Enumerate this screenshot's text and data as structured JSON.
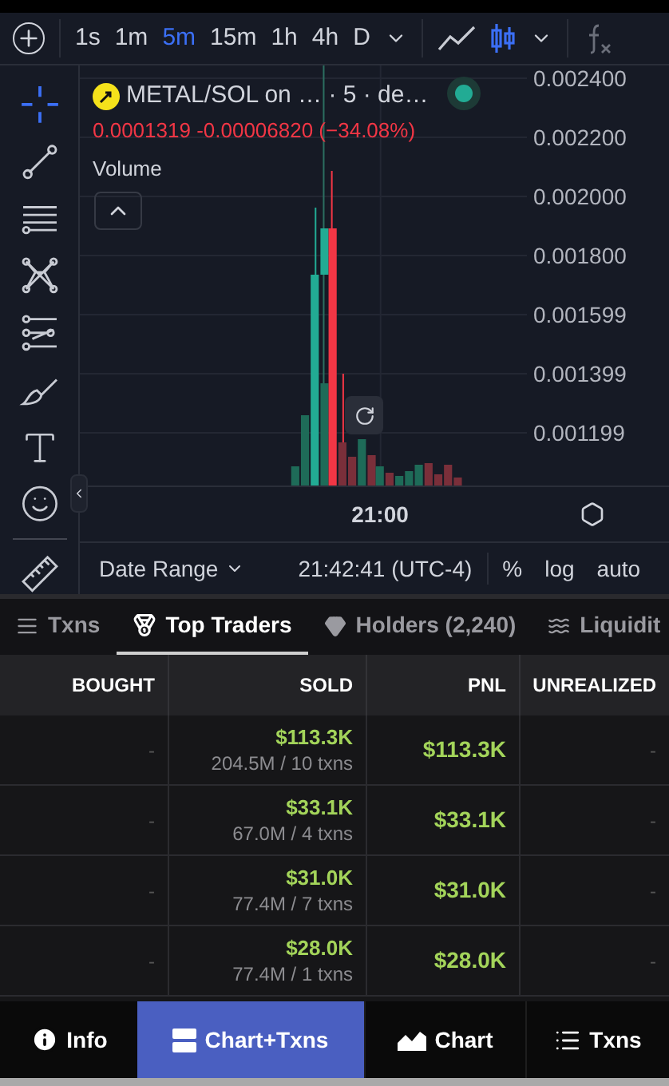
{
  "intervals": [
    {
      "label": "1s",
      "selected": false
    },
    {
      "label": "1m",
      "selected": false
    },
    {
      "label": "5m",
      "selected": true
    },
    {
      "label": "15m",
      "selected": false
    },
    {
      "label": "1h",
      "selected": false
    },
    {
      "label": "4h",
      "selected": false
    },
    {
      "label": "D",
      "selected": false
    }
  ],
  "chart_types": [
    {
      "kind": "line",
      "selected": false
    },
    {
      "kind": "candles",
      "selected": true
    }
  ],
  "drawing_tools": [
    {
      "kind": "crosshair",
      "selected": true
    },
    {
      "kind": "trend-line",
      "selected": false
    },
    {
      "kind": "fib",
      "selected": false
    },
    {
      "kind": "pattern",
      "selected": false
    },
    {
      "kind": "channel",
      "selected": false
    },
    {
      "kind": "brush",
      "selected": false
    },
    {
      "kind": "text",
      "selected": false
    },
    {
      "kind": "emoji",
      "selected": false
    },
    {
      "kind": "ruler",
      "selected": false
    }
  ],
  "legend": {
    "title": "METAL/SOL on … · 5 · de…",
    "reading": "0.0001319 -0.00006820 (−34.08%)",
    "indicator": "Volume",
    "live": true
  },
  "price_axis": [
    "0.002400",
    "0.002200",
    "0.002000",
    "0.001800",
    "0.001599",
    "0.001399",
    "0.001199"
  ],
  "time_axis": [
    "21:00"
  ],
  "footer": {
    "date_range": "Date Range",
    "time": "21:42:41 (UTC-4)",
    "options": [
      "%",
      "log",
      "auto"
    ]
  },
  "tabs": [
    {
      "label": "Txns",
      "kind": "txns",
      "selected": false
    },
    {
      "label": "Top Traders",
      "kind": "traders",
      "selected": true
    },
    {
      "label": "Holders (2,240)",
      "kind": "holders",
      "selected": false
    },
    {
      "label": "Liquidit",
      "kind": "liquidity",
      "selected": false
    }
  ],
  "table": {
    "columns": [
      "BOUGHT",
      "SOLD",
      "PNL",
      "UNREALIZED"
    ],
    "rows": [
      {
        "bought": "-",
        "sold": "$113.3K",
        "sold_detail": "204.5M / 10 txns",
        "pnl": "$113.3K",
        "unrealized": "-"
      },
      {
        "bought": "-",
        "sold": "$33.1K",
        "sold_detail": "67.0M / 4 txns",
        "pnl": "$33.1K",
        "unrealized": "-"
      },
      {
        "bought": "-",
        "sold": "$31.0K",
        "sold_detail": "77.4M / 7 txns",
        "pnl": "$31.0K",
        "unrealized": "-"
      },
      {
        "bought": "-",
        "sold": "$28.0K",
        "sold_detail": "77.4M / 1 txns",
        "pnl": "$28.0K",
        "unrealized": "-"
      }
    ]
  },
  "nav": [
    {
      "label": "Info",
      "kind": "info",
      "selected": false
    },
    {
      "label": "Chart+Txns",
      "kind": "split",
      "selected": true
    },
    {
      "label": "Chart",
      "kind": "chart",
      "selected": false
    },
    {
      "label": "Txns",
      "kind": "list",
      "selected": false
    }
  ]
}
